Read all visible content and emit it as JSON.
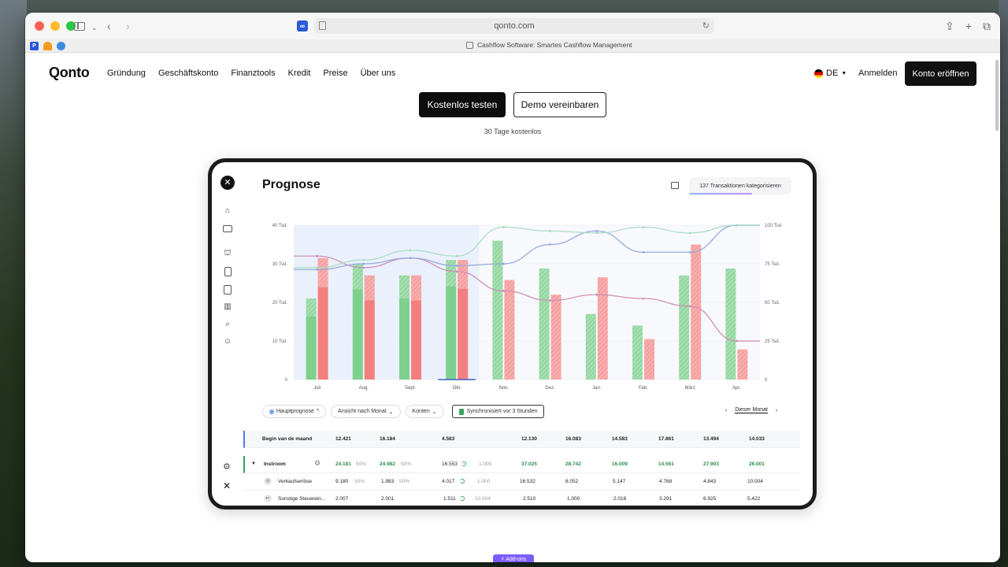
{
  "browser": {
    "url": "qonto.com",
    "tab_title": "Cashflow Software: Smartes Cashflow Management"
  },
  "site": {
    "logo": "Qonto",
    "nav": [
      "Gründung",
      "Geschäftskonto",
      "Finanztools",
      "Kredit",
      "Preise",
      "Über uns"
    ],
    "language": "DE",
    "login": "Anmelden",
    "open_account": "Konto eröffnen",
    "cta_primary": "Kostenlos testen",
    "cta_secondary": "Demo vereinbaren",
    "trial_note": "30 Tage kostenlos",
    "addons_badge": "⚡ Add-ons"
  },
  "app": {
    "title": "Prognose",
    "transactions_chip": "137 Transaktionen kategorisieren",
    "filters": {
      "main_forecast": "Hauptprognose",
      "view": "Ansicht nach Monat",
      "accounts": "Konten",
      "sync": "Synchronisiert vor 3 Stunden"
    },
    "month_nav": "Dieser Monat",
    "table": {
      "begin": {
        "label": "Begin van de maand",
        "values": [
          "12.421",
          "16.184",
          "4.583",
          "12.130",
          "16.083",
          "14.583",
          "17.861",
          "13.494",
          "14.033"
        ]
      },
      "instroom": {
        "label": "Instroom",
        "c1": "24.181",
        "p1": "50%",
        "c2": "24.982",
        "p2": "50%",
        "c3": "16.553",
        "c3b": "1.000",
        "values": [
          "37.025",
          "28.742",
          "16.009",
          "14.561",
          "27.903",
          "26.001"
        ]
      },
      "verkauf": {
        "label": "Verkaufserlöse",
        "c1": "9.180",
        "p1": "50%",
        "c2": "1.983",
        "p2": "50%",
        "c3": "4.017",
        "c3b": "1.000",
        "values": [
          "16.532",
          "8.052",
          "5.147",
          "4.768",
          "4.843",
          "10.004"
        ]
      },
      "sonstige": {
        "label": "Sonstige Steuerein...",
        "c1": "2.007",
        "c2": "2.001",
        "c3": "1.511",
        "c3b": "10.004",
        "values": [
          "2.510",
          "1.000",
          "2.018",
          "3.291",
          "6.925",
          "5.422"
        ]
      }
    }
  },
  "chart_data": {
    "type": "bar",
    "categories": [
      "Juli",
      "Aug.",
      "Sept.",
      "Okt.",
      "Nov.",
      "Dez.",
      "Jan.",
      "Feb.",
      "März",
      "Apr."
    ],
    "y_left_ticks": [
      "0",
      "10 Tsd.",
      "20 Tsd.",
      "30 Tsd.",
      "40 Tsd."
    ],
    "y_right_ticks": [
      "0",
      "25 Tsd.",
      "50 Tsd.",
      "75 Tsd.",
      "100 Tsd."
    ],
    "ylim_left": [
      0,
      40000
    ],
    "ylim_right": [
      0,
      100000
    ],
    "series": [
      {
        "values": [
          21000,
          30000,
          27000,
          31000,
          36000,
          28800,
          17000,
          14000,
          27000,
          28800
        ],
        "color": "#7fd08d"
      },
      {
        "values": [
          31500,
          27000,
          27000,
          31000,
          25800,
          22000,
          26500,
          10500,
          35000,
          7800
        ],
        "color": "#f47f7f"
      }
    ],
    "lines": [
      {
        "values": [
          32000,
          29000,
          31500,
          28000,
          23000,
          20500,
          22000,
          21000,
          19000,
          10000
        ],
        "axis": "left",
        "color": "#cc8fb4"
      },
      {
        "values": [
          28500,
          30000,
          31500,
          29500,
          30000,
          35000,
          38500,
          33000,
          33000,
          40000
        ],
        "axis": "left",
        "color": "#93a9d9"
      },
      {
        "values": [
          29000,
          31000,
          33500,
          32000,
          39500,
          38500,
          38000,
          39500,
          38000,
          40000
        ],
        "axis": "left",
        "color": "#a8dcc4"
      }
    ],
    "actual_months": 4,
    "grid": true
  }
}
